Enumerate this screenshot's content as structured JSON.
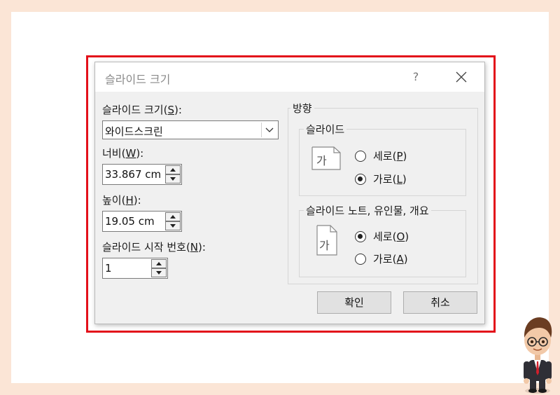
{
  "dialog": {
    "title": "슬라이드 크기",
    "help": "?"
  },
  "slide_size": {
    "label_text": "슬라이드 크기",
    "label_key": "S",
    "label_suffix": "):",
    "value": "와이드스크린"
  },
  "width": {
    "label_text": "너비",
    "label_key": "W",
    "label_suffix": "):",
    "value": "33.867 cm"
  },
  "height": {
    "label_text": "높이",
    "label_key": "H",
    "label_suffix": "):",
    "value": "19.05 cm"
  },
  "start_number": {
    "label_text": "슬라이드 시작 번호",
    "label_key": "N",
    "label_suffix": "):",
    "value": "1"
  },
  "orientation": {
    "title": "방향",
    "slides_group": {
      "title": "슬라이드",
      "icon_glyph": "가",
      "portrait_text": "세로",
      "portrait_key": "P",
      "landscape_text": "가로",
      "landscape_key": "L",
      "selected": "landscape"
    },
    "notes_group": {
      "title": "슬라이드 노트, 유인물, 개요",
      "icon_glyph": "가",
      "portrait_text": "세로",
      "portrait_key": "O",
      "landscape_text": "가로",
      "landscape_key": "A",
      "selected": "portrait"
    }
  },
  "buttons": {
    "ok": "확인",
    "cancel": "취소"
  },
  "open_paren": "(",
  "close_paren": ")"
}
